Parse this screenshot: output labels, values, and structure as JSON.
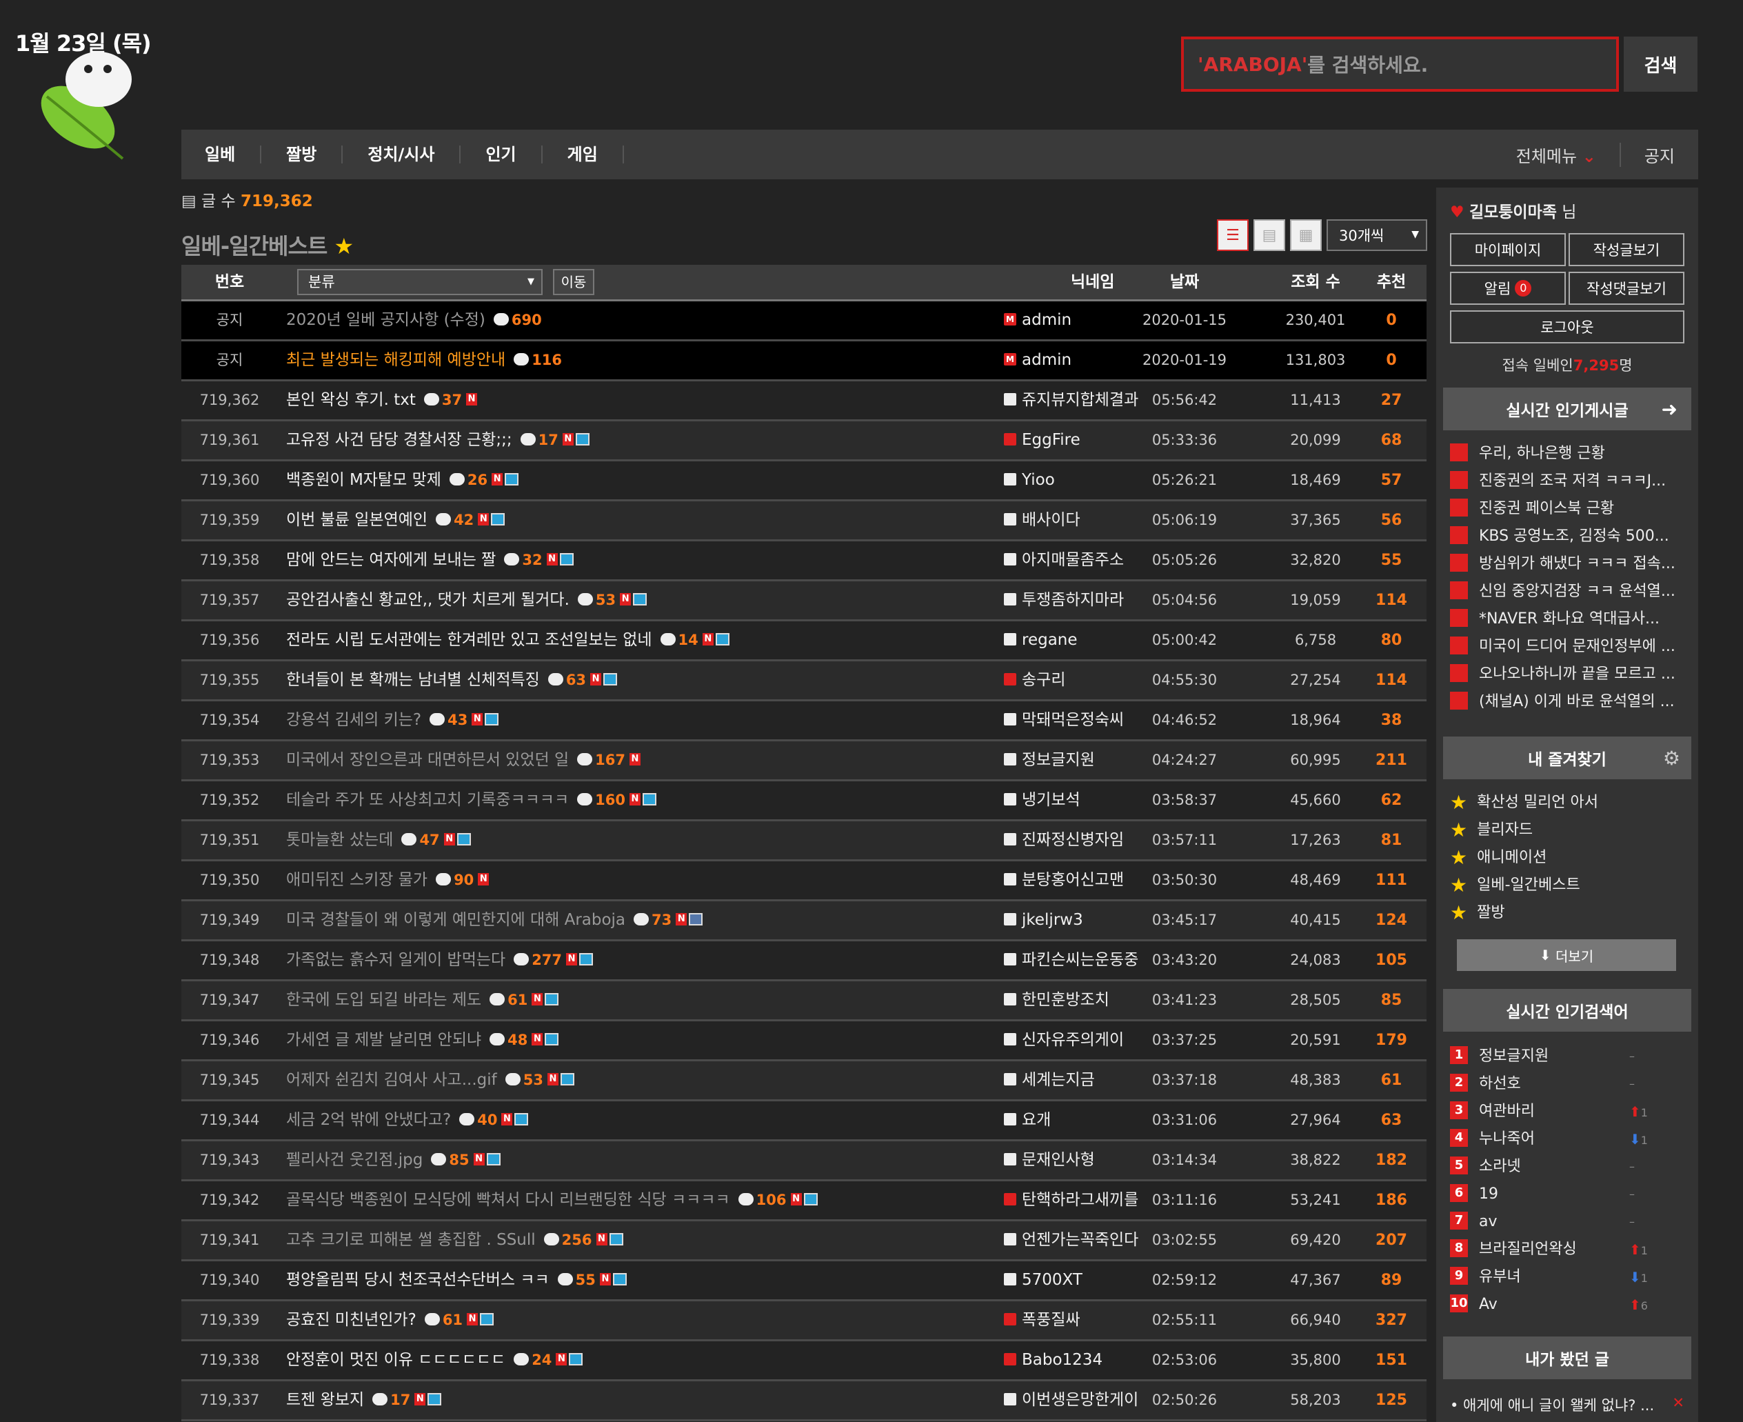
{
  "header": {
    "date": "1월 23일 (목)",
    "search_keyword": "'ARABOJA'",
    "search_suffix": " 를 검색하세요.",
    "search_button": "검색"
  },
  "nav": {
    "items": [
      "일베",
      "짤방",
      "정치/시사",
      "인기",
      "게임"
    ],
    "all_menu": "전체메뉴",
    "notice": "공지"
  },
  "board": {
    "count_label": "글 수",
    "count": "719,362",
    "title": "일베-일간베스트",
    "per_page": "30개씩"
  },
  "table": {
    "headers": {
      "no": "번호",
      "category": "분류",
      "move": "이동",
      "nick": "닉네임",
      "date": "날짜",
      "views": "조회 수",
      "rec": "추천"
    },
    "rows": [
      {
        "no": "공지",
        "title": "2020년 일베 공지사항 (수정)",
        "cmt": "690",
        "nick": "admin",
        "date": "2020-01-15",
        "views": "230,401",
        "rec": "0"
      },
      {
        "no": "공지",
        "title": "최근 발생되는 해킹피해 예방안내",
        "cmt": "116",
        "nick": "admin",
        "date": "2020-01-19",
        "views": "131,803",
        "rec": "0"
      },
      {
        "no": "719,362",
        "title": "본인 왁싱 후기. txt",
        "cmt": "37",
        "nick": "쥬지뷰지합체결과",
        "date": "05:56:42",
        "views": "11,413",
        "rec": "27"
      },
      {
        "no": "719,361",
        "title": "고유정 사건 담당 경찰서장 근황;;;",
        "cmt": "17",
        "nick": "EggFire",
        "date": "05:33:36",
        "views": "20,099",
        "rec": "68"
      },
      {
        "no": "719,360",
        "title": "백종원이 M자탈모 맞제",
        "cmt": "26",
        "nick": "Yioo",
        "date": "05:26:21",
        "views": "18,469",
        "rec": "57"
      },
      {
        "no": "719,359",
        "title": "이번 불륜 일본연예인",
        "cmt": "42",
        "nick": "배사이다",
        "date": "05:06:19",
        "views": "37,365",
        "rec": "56"
      },
      {
        "no": "719,358",
        "title": "맘에 안드는 여자에게 보내는 짤",
        "cmt": "32",
        "nick": "아지매물좀주소",
        "date": "05:05:26",
        "views": "32,820",
        "rec": "55"
      },
      {
        "no": "719,357",
        "title": "공안검사출신 황교안,, 댓가 치르게 될거다.",
        "cmt": "53",
        "nick": "투쟁좀하지마라",
        "date": "05:04:56",
        "views": "19,059",
        "rec": "114"
      },
      {
        "no": "719,356",
        "title": "전라도 시립 도서관에는 한겨레만 있고 조선일보는 없네",
        "cmt": "14",
        "nick": "regane",
        "date": "05:00:42",
        "views": "6,758",
        "rec": "80"
      },
      {
        "no": "719,355",
        "title": "한녀들이 본 확깨는 남녀별 신체적특징",
        "cmt": "63",
        "nick": "송구리",
        "date": "04:55:30",
        "views": "27,254",
        "rec": "114"
      },
      {
        "no": "719,354",
        "title": "강용석 김세의 키는?",
        "cmt": "43",
        "nick": "막돼먹은정숙씨",
        "date": "04:46:52",
        "views": "18,964",
        "rec": "38"
      },
      {
        "no": "719,353",
        "title": "미국에서 장인으른과 대면하믄서 있었던 일",
        "cmt": "167",
        "nick": "정보글지원",
        "date": "04:24:27",
        "views": "60,995",
        "rec": "211"
      },
      {
        "no": "719,352",
        "title": "테슬라 주가 또 사상최고치 기록중ㅋㅋㅋㅋ",
        "cmt": "160",
        "nick": "냉기보석",
        "date": "03:58:37",
        "views": "45,660",
        "rec": "62"
      },
      {
        "no": "719,351",
        "title": "톳마늘환 샀는데",
        "cmt": "47",
        "nick": "진짜정신병자임",
        "date": "03:57:11",
        "views": "17,263",
        "rec": "81"
      },
      {
        "no": "719,350",
        "title": "애미뒤진 스키장 물가",
        "cmt": "90",
        "nick": "분탕홍어신고맨",
        "date": "03:50:30",
        "views": "48,469",
        "rec": "111"
      },
      {
        "no": "719,349",
        "title": "미국 경찰들이 왜 이렇게 예민한지에 대해 Araboja",
        "cmt": "73",
        "nick": "jkeljrw3",
        "date": "03:45:17",
        "views": "40,415",
        "rec": "124"
      },
      {
        "no": "719,348",
        "title": "가족없는 흙수저 일게이 밥먹는다",
        "cmt": "277",
        "nick": "파킨슨씨는운동중",
        "date": "03:43:20",
        "views": "24,083",
        "rec": "105"
      },
      {
        "no": "719,347",
        "title": "한국에 도입 되길 바라는 제도",
        "cmt": "61",
        "nick": "한민훈방조치",
        "date": "03:41:23",
        "views": "28,505",
        "rec": "85"
      },
      {
        "no": "719,346",
        "title": "가세연 글 제발 날리면 안되냐",
        "cmt": "48",
        "nick": "신자유주의게이",
        "date": "03:37:25",
        "views": "20,591",
        "rec": "179"
      },
      {
        "no": "719,345",
        "title": "어제자 쉰김치 김여사 사고...gif",
        "cmt": "53",
        "nick": "세계는지금",
        "date": "03:37:18",
        "views": "48,383",
        "rec": "61"
      },
      {
        "no": "719,344",
        "title": "세금 2억 밖에 안냈다고?",
        "cmt": "40",
        "nick": "요개",
        "date": "03:31:06",
        "views": "27,964",
        "rec": "63"
      },
      {
        "no": "719,343",
        "title": "펠리사건 웃긴점.jpg",
        "cmt": "85",
        "nick": "문재인사형",
        "date": "03:14:34",
        "views": "38,822",
        "rec": "182"
      },
      {
        "no": "719,342",
        "title": "골목식당 백종원이 모식당에 빡쳐서 다시 리브랜딩한 식당 ㅋㅋㅋㅋ",
        "cmt": "106",
        "nick": "탄핵하라그새끼를",
        "date": "03:11:16",
        "views": "53,241",
        "rec": "186"
      },
      {
        "no": "719,341",
        "title": "고추 크기로 피해본 썰 총집합 . SSull",
        "cmt": "256",
        "nick": "언젠가는꼭죽인다",
        "date": "03:02:55",
        "views": "69,420",
        "rec": "207"
      },
      {
        "no": "719,340",
        "title": "평양올림픽 당시 천조국선수단버스 ㅋㅋ",
        "cmt": "55",
        "nick": "5700XT",
        "date": "02:59:12",
        "views": "47,367",
        "rec": "89"
      },
      {
        "no": "719,339",
        "title": "공효진 미친년인가?",
        "cmt": "61",
        "nick": "폭풍질싸",
        "date": "02:55:11",
        "views": "66,940",
        "rec": "327"
      },
      {
        "no": "719,338",
        "title": "안정훈이 멋진 이유 ㄷㄷㄷㄷㄷㄷ",
        "cmt": "24",
        "nick": "Babo1234",
        "date": "02:53:06",
        "views": "35,800",
        "rec": "151"
      },
      {
        "no": "719,337",
        "title": "트젠 왕보지",
        "cmt": "17",
        "nick": "이번생은망한게이",
        "date": "02:50:26",
        "views": "58,203",
        "rec": "125"
      }
    ]
  },
  "sidebar": {
    "user_name": "길모퉁이마족",
    "user_suffix": " 님",
    "buttons": {
      "mypage": "마이페이지",
      "my_posts": "작성글보기",
      "alarm": "알림",
      "alarm_count": "0",
      "my_comments": "작성댓글보기",
      "logout": "로그아웃"
    },
    "online_prefix": "접속 일베인",
    "online_count": "7,295",
    "online_suffix": "명",
    "realtime_title": "실시간 인기게시글",
    "realtime": [
      "우리, 하나은행 근황",
      "진중권의 조국 저격 ㅋㅋㅋJ...",
      "진중권 페이스북 근황",
      "KBS 공영노조, 김정숙 500...",
      "방심위가 해냈다 ㅋㅋㅋ 접속...",
      "신임 중앙지검장 ㅋㅋ 윤석열...",
      "*NAVER 화나요 역대급사...",
      "미국이 드디어 문재인정부에 ...",
      "오나오나하니까 끝을 모르고 ...",
      "(채널A) 이게 바로 윤석열의 ..."
    ],
    "fav_title": "내 즐겨찾기",
    "favorites": [
      "확산성 밀리언 아서",
      "블리자드",
      "애니메이션",
      "일베-일간베스트",
      "짤방"
    ],
    "more": "더보기",
    "search_title": "실시간 인기검색어",
    "ranks": [
      {
        "n": "1",
        "k": "정보글지원",
        "ch": "–"
      },
      {
        "n": "2",
        "k": "하선호",
        "ch": "–"
      },
      {
        "n": "3",
        "k": "여관바리",
        "ch": "1",
        "dir": "up"
      },
      {
        "n": "4",
        "k": "누나죽어",
        "ch": "1",
        "dir": "down"
      },
      {
        "n": "5",
        "k": "소라넷",
        "ch": "–"
      },
      {
        "n": "6",
        "k": "19",
        "ch": "–"
      },
      {
        "n": "7",
        "k": "av",
        "ch": "–"
      },
      {
        "n": "8",
        "k": "브라질리언왁싱",
        "ch": "1",
        "dir": "up"
      },
      {
        "n": "9",
        "k": "유부녀",
        "ch": "1",
        "dir": "down"
      },
      {
        "n": "10",
        "k": "Av",
        "ch": "6",
        "dir": "up"
      }
    ],
    "viewed_title": "내가 봤던 글",
    "viewed_item": "• 애게에 애니 글이 왤케 없냐? ..."
  },
  "colors": {
    "accent": "#e02020",
    "orange": "#ff7a1a",
    "bg": "#232323"
  }
}
